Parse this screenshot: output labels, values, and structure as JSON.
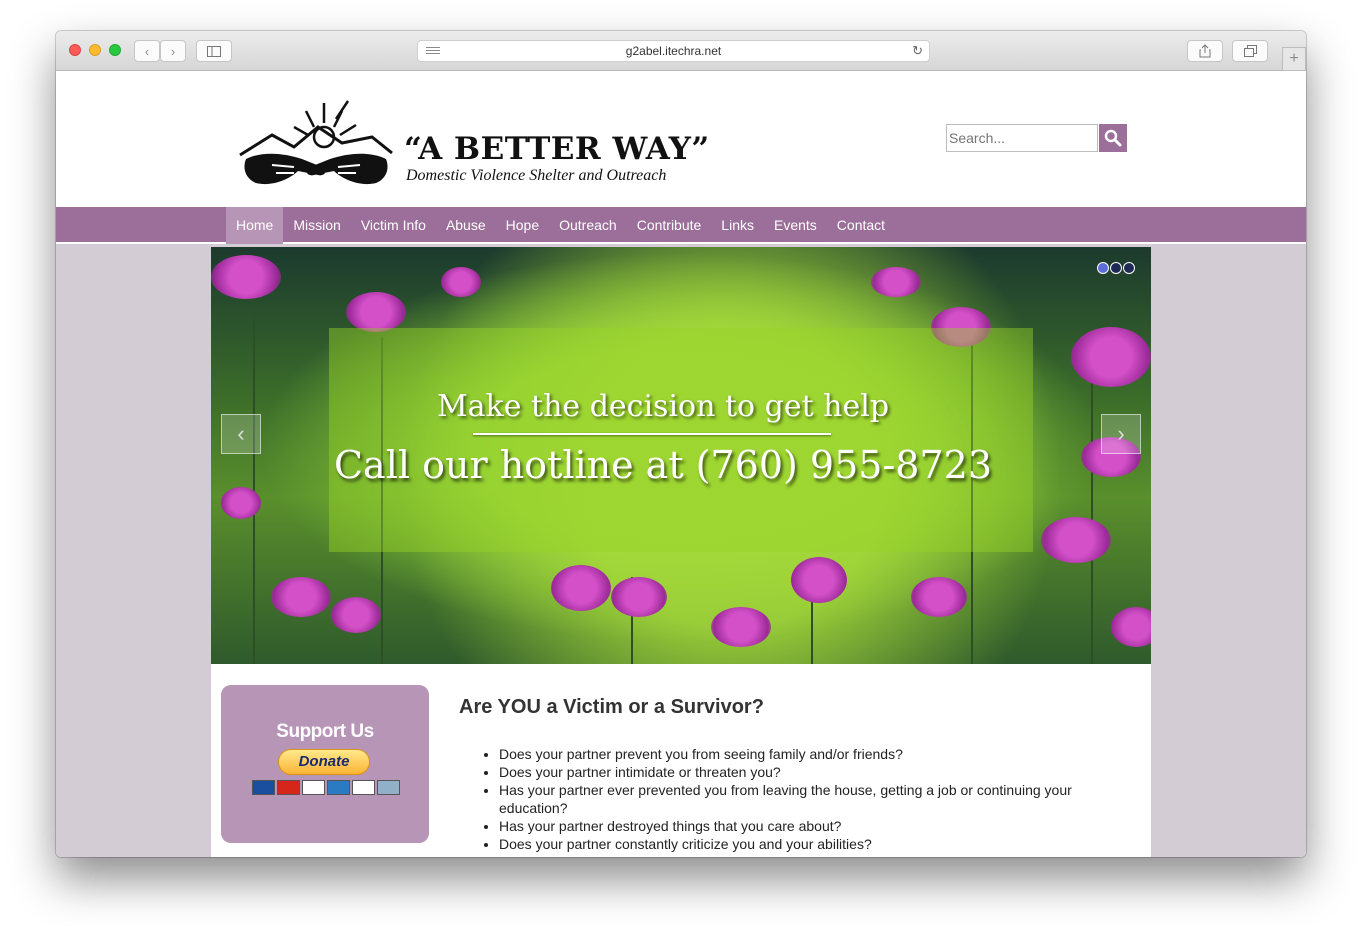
{
  "browser": {
    "url": "g2abel.itechra.net"
  },
  "site": {
    "logo_title": "“A BETTER WAY”",
    "logo_subtitle": "Domestic Violence Shelter and Outreach",
    "search_placeholder": "Search..."
  },
  "nav": {
    "items": [
      "Home",
      "Mission",
      "Victim Info",
      "Abuse",
      "Hope",
      "Outreach",
      "Contribute",
      "Links",
      "Events",
      "Contact"
    ],
    "active": "Home"
  },
  "slider": {
    "line1": "Make the decision to get help",
    "line2": "Call our hotline at (760) 955-8723",
    "prev": "‹",
    "next": "›",
    "slide_count": 3,
    "active_slide": 1
  },
  "support": {
    "title": "Support Us",
    "donate_label": "Donate"
  },
  "article": {
    "title": "Are YOU a Victim or a Survivor?",
    "questions": [
      "Does your partner prevent you from seeing family and/or friends?",
      "Does your partner intimidate or threaten you?",
      "Has your partner ever prevented you from leaving the house, getting a job or continuing your education?",
      "Has your partner destroyed things that you care about?",
      "Does your partner constantly criticize you and your abilities?"
    ]
  },
  "colors": {
    "nav_bg": "#9b6f9a",
    "nav_active": "#b795b6",
    "page_bg": "#d3ccd5",
    "support_bg": "#b795b6"
  }
}
